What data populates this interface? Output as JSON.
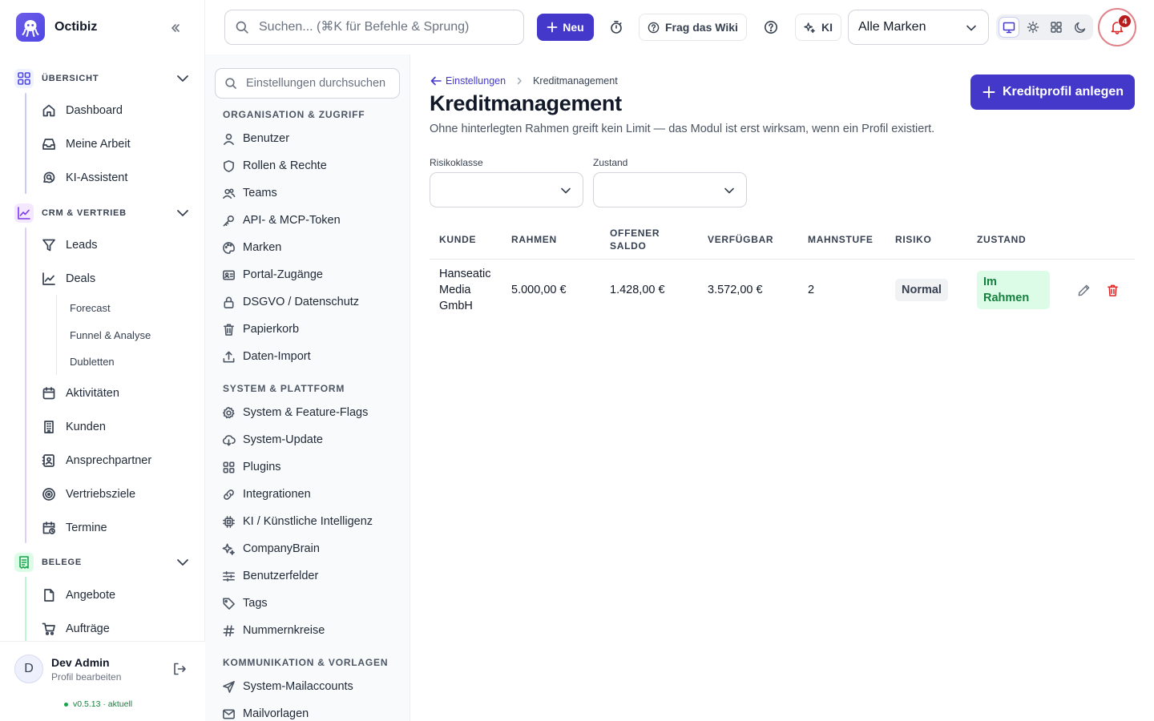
{
  "app": {
    "name": "Octibiz",
    "accent": "#4338ca"
  },
  "sidebar": {
    "sections": [
      {
        "label": "ÜBERSICHT",
        "icon": "grid-icon",
        "color": "#4f46e5",
        "items": [
          {
            "label": "Dashboard",
            "icon": "home-icon"
          },
          {
            "label": "Meine Arbeit",
            "icon": "inbox-icon"
          },
          {
            "label": "KI-Assistent",
            "icon": "chat-search-icon"
          }
        ]
      },
      {
        "label": "CRM & VERTRIEB",
        "icon": "chart-line-icon",
        "color": "#7c3aed",
        "items": [
          {
            "label": "Leads",
            "icon": "funnel-icon"
          },
          {
            "label": "Deals",
            "icon": "trend-icon"
          },
          {
            "label": "Aktivitäten",
            "icon": "calendar-icon"
          },
          {
            "label": "Kunden",
            "icon": "building-icon"
          },
          {
            "label": "Ansprechpartner",
            "icon": "contact-card-icon"
          },
          {
            "label": "Vertriebsziele",
            "icon": "target-icon"
          },
          {
            "label": "Termine",
            "icon": "calendar-clock-icon"
          }
        ],
        "deals_sub": [
          "Forecast",
          "Funnel & Analyse",
          "Dubletten"
        ]
      },
      {
        "label": "BELEGE",
        "icon": "receipt-icon",
        "color": "#16a34a",
        "items": [
          {
            "label": "Angebote",
            "icon": "document-icon"
          },
          {
            "label": "Aufträge",
            "icon": "cart-icon"
          }
        ]
      }
    ],
    "user": {
      "initial": "D",
      "name": "Dev Admin",
      "sub": "Profil bearbeiten"
    },
    "version": "v0.5.13 · aktuell"
  },
  "topbar": {
    "search_placeholder": "Suchen... (⌘K für Befehle & Sprung)",
    "new_label": "Neu",
    "wiki_label": "Frag das Wiki",
    "ai_label": "KI",
    "brand_select": "Alle Marken",
    "notifications": "4"
  },
  "settings_nav": {
    "search_placeholder": "Einstellungen durchsuchen",
    "groups": [
      {
        "title": "ORGANISATION & ZUGRIFF",
        "items": [
          {
            "label": "Benutzer",
            "icon": "user-icon"
          },
          {
            "label": "Rollen & Rechte",
            "icon": "shield-icon"
          },
          {
            "label": "Teams",
            "icon": "users-icon"
          },
          {
            "label": "API- & MCP-Token",
            "icon": "key-icon"
          },
          {
            "label": "Marken",
            "icon": "palette-icon"
          },
          {
            "label": "Portal-Zugänge",
            "icon": "id-card-icon"
          },
          {
            "label": "DSGVO / Datenschutz",
            "icon": "lock-icon"
          },
          {
            "label": "Papierkorb",
            "icon": "trash-icon"
          },
          {
            "label": "Daten-Import",
            "icon": "upload-icon"
          }
        ]
      },
      {
        "title": "SYSTEM & PLATTFORM",
        "items": [
          {
            "label": "System & Feature-Flags",
            "icon": "gear-icon"
          },
          {
            "label": "System-Update",
            "icon": "cloud-download-icon"
          },
          {
            "label": "Plugins",
            "icon": "grid-icon"
          },
          {
            "label": "Integrationen",
            "icon": "link-icon"
          },
          {
            "label": "KI / Künstliche Intelligenz",
            "icon": "chip-icon"
          },
          {
            "label": "CompanyBrain",
            "icon": "sparkle-icon"
          },
          {
            "label": "Benutzerfelder",
            "icon": "sliders-icon"
          },
          {
            "label": "Tags",
            "icon": "tag-icon"
          },
          {
            "label": "Nummernkreise",
            "icon": "hash-icon"
          }
        ]
      },
      {
        "title": "KOMMUNIKATION & VORLAGEN",
        "items": [
          {
            "label": "System-Mailaccounts",
            "icon": "send-icon"
          },
          {
            "label": "Mailvorlagen",
            "icon": "mail-icon"
          }
        ]
      }
    ]
  },
  "main": {
    "breadcrumb": {
      "back": "Einstellungen",
      "current": "Kreditmanagement"
    },
    "title": "Kreditmanagement",
    "description": "Ohne hinterlegten Rahmen greift kein Limit — das Modul ist erst wirksam, wenn ein Profil existiert.",
    "primary_button": "Kreditprofil anlegen",
    "filters": [
      {
        "label": "Risikoklasse",
        "value": ""
      },
      {
        "label": "Zustand",
        "value": ""
      }
    ],
    "table": {
      "columns": [
        "KUNDE",
        "RAHMEN",
        "OFFENER SALDO",
        "VERFÜGBAR",
        "MAHNSTUFE",
        "RISIKO",
        "ZUSTAND"
      ],
      "rows": [
        {
          "kunde": "Hanseatic Media GmbH",
          "rahmen": "5.000,00 €",
          "saldo": "1.428,00 €",
          "verfuegbar": "3.572,00 €",
          "mahnstufe": "2",
          "risiko": "Normal",
          "zustand": "Im Rahmen"
        }
      ]
    }
  }
}
